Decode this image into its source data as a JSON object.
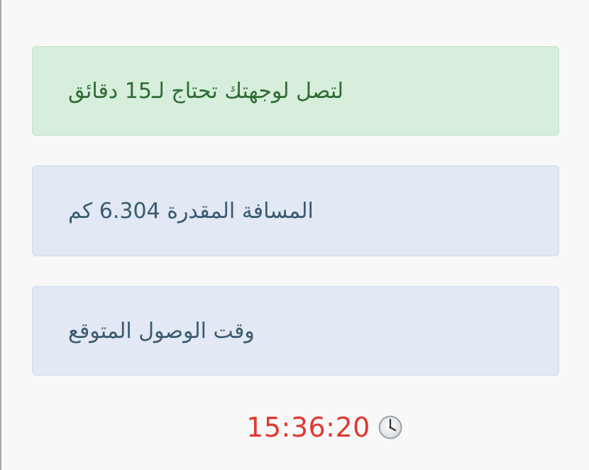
{
  "cards": {
    "duration": "لتصل لوجهتك تحتاج لـ15 دقائق",
    "distance": "المسافة المقدرة 6.304 كم",
    "arrival": "وقت الوصول المتوقع"
  },
  "arrival_time": {
    "value": "15:36:20",
    "icon": "clock-icon"
  },
  "colors": {
    "success_bg": "#d6eedb",
    "success_text": "#2f6a35",
    "info_bg": "#e2e8f4",
    "info_text": "#3a5a70",
    "time_text": "#e0382e"
  }
}
